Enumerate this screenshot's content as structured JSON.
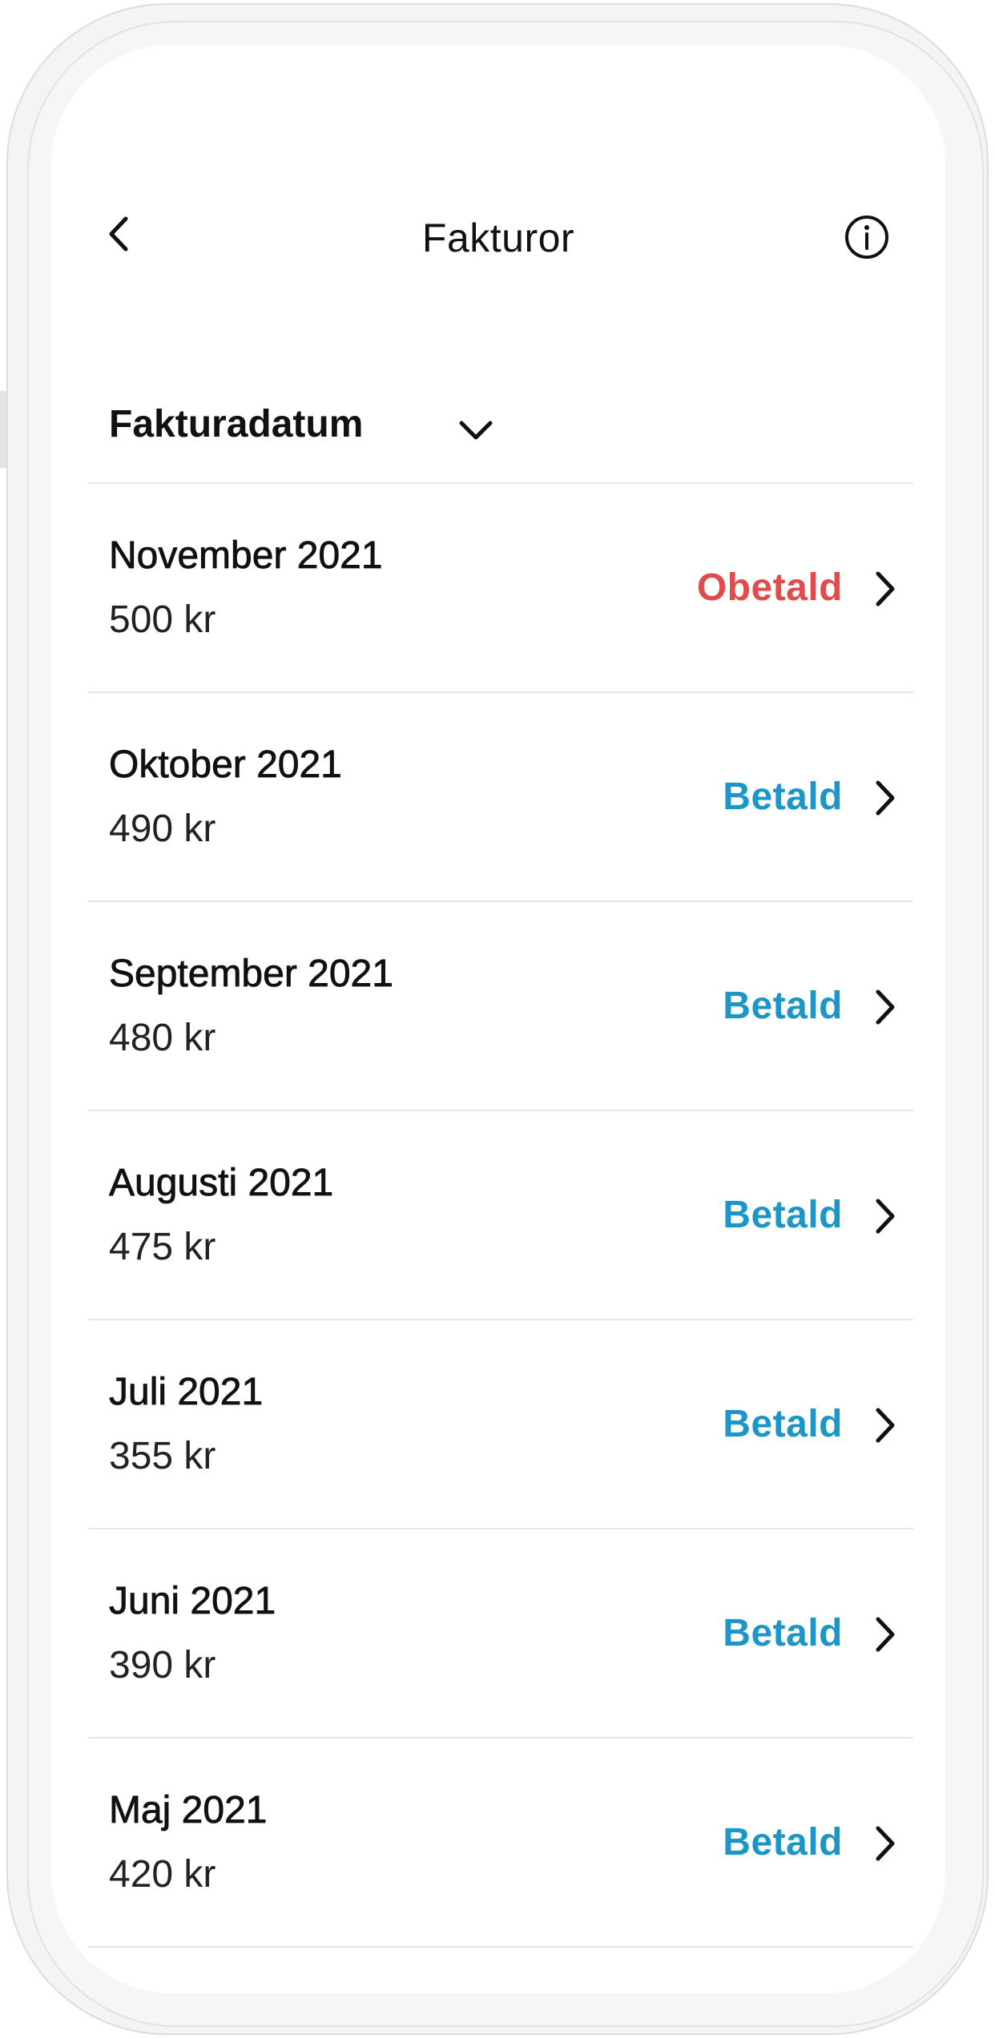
{
  "header": {
    "title": "Fakturor",
    "back_icon": "chevron-left-icon",
    "info_icon": "info-circle-icon"
  },
  "sort": {
    "label": "Fakturadatum",
    "icon": "chevron-down-icon"
  },
  "colors": {
    "unpaid": "#e04b4b",
    "paid": "#1b96c6",
    "text": "#111111",
    "divider": "#e6e6e6"
  },
  "invoices": [
    {
      "month": "November 2021",
      "amount": "500 kr",
      "status": "Obetald",
      "paid": false
    },
    {
      "month": "Oktober 2021",
      "amount": "490 kr",
      "status": "Betald",
      "paid": true
    },
    {
      "month": "September 2021",
      "amount": "480 kr",
      "status": "Betald",
      "paid": true
    },
    {
      "month": "Augusti 2021",
      "amount": "475 kr",
      "status": "Betald",
      "paid": true
    },
    {
      "month": "Juli 2021",
      "amount": "355 kr",
      "status": "Betald",
      "paid": true
    },
    {
      "month": "Juni 2021",
      "amount": "390 kr",
      "status": "Betald",
      "paid": true
    },
    {
      "month": "Maj 2021",
      "amount": "420 kr",
      "status": "Betald",
      "paid": true
    }
  ]
}
